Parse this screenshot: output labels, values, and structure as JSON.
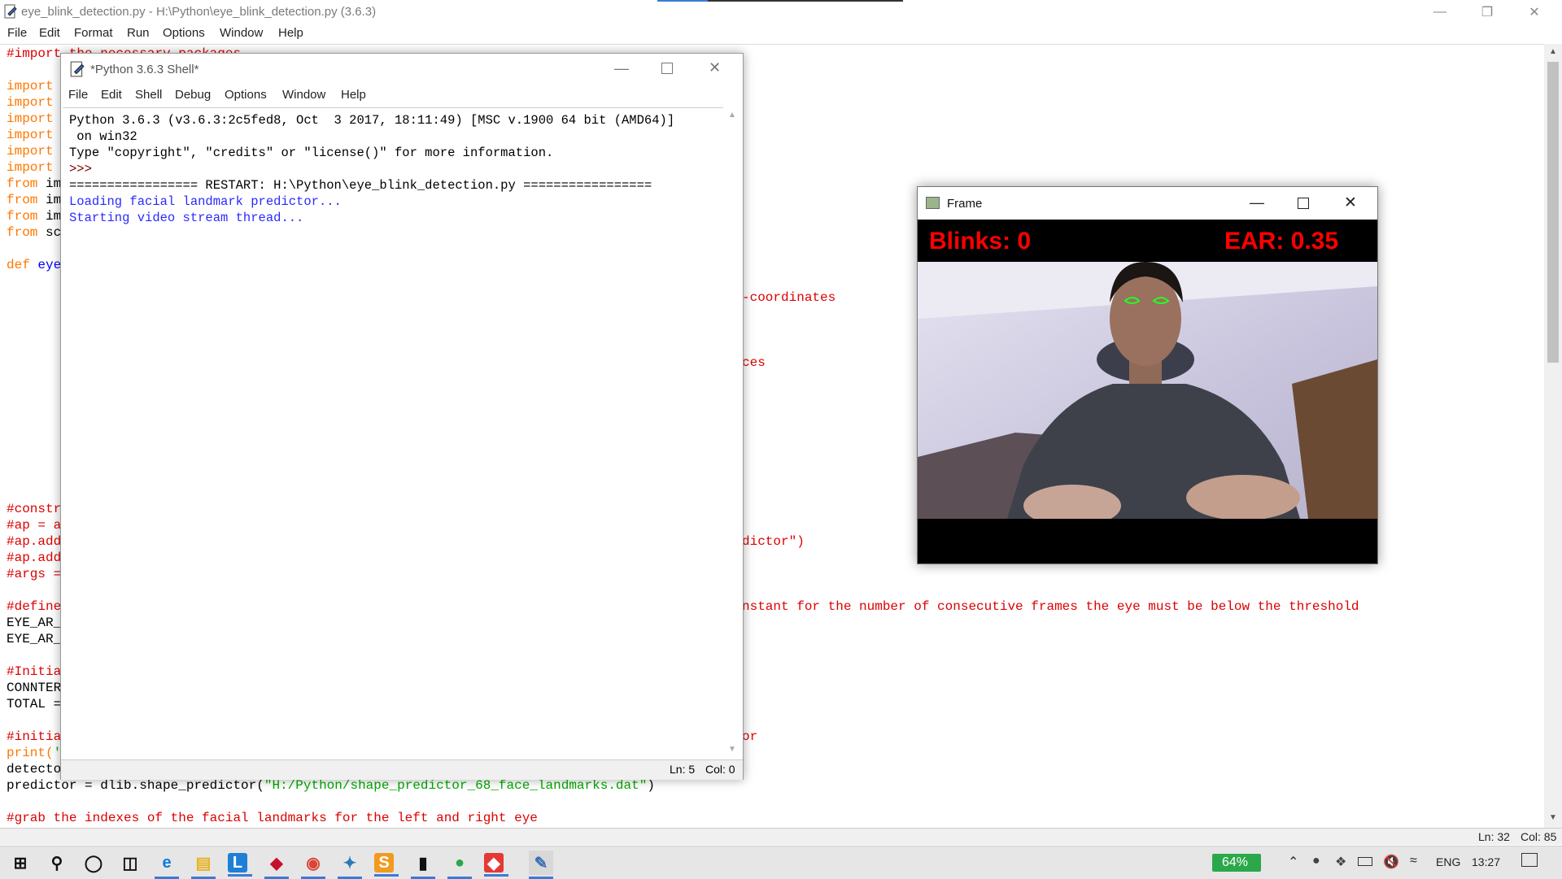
{
  "editor": {
    "title": "eye_blink_detection.py - H:\\Python\\eye_blink_detection.py (3.6.3)",
    "menu": [
      "File",
      "Edit",
      "Format",
      "Run",
      "Options",
      "Window",
      "Help"
    ],
    "code_lines": [
      {
        "parts": [
          {
            "t": "#import",
            "c": "cm"
          },
          {
            "t": " the necessary packages",
            "c": "cm"
          }
        ]
      },
      {
        "parts": []
      },
      {
        "parts": [
          {
            "t": "import",
            "c": "kw"
          }
        ]
      },
      {
        "parts": [
          {
            "t": "import",
            "c": "kw"
          }
        ]
      },
      {
        "parts": [
          {
            "t": "import",
            "c": "kw"
          }
        ]
      },
      {
        "parts": [
          {
            "t": "import",
            "c": "kw"
          }
        ]
      },
      {
        "parts": [
          {
            "t": "import",
            "c": "kw"
          }
        ]
      },
      {
        "parts": [
          {
            "t": "import",
            "c": "kw"
          }
        ]
      },
      {
        "parts": [
          {
            "t": "from",
            "c": "kw"
          },
          {
            "t": " im",
            "c": "tx"
          }
        ]
      },
      {
        "parts": [
          {
            "t": "from",
            "c": "kw"
          },
          {
            "t": " im",
            "c": "tx"
          }
        ]
      },
      {
        "parts": [
          {
            "t": "from",
            "c": "kw"
          },
          {
            "t": " im",
            "c": "tx"
          }
        ]
      },
      {
        "parts": [
          {
            "t": "from",
            "c": "kw"
          },
          {
            "t": " sc",
            "c": "tx"
          }
        ]
      },
      {
        "parts": []
      },
      {
        "parts": [
          {
            "t": "def",
            "c": "kw"
          },
          {
            "t": " eye",
            "c": "df"
          }
        ]
      }
    ],
    "code_lines_lower": [
      {
        "parts": [
          {
            "t": "#constr",
            "c": "cm"
          }
        ]
      },
      {
        "parts": [
          {
            "t": "#ap = a",
            "c": "cm"
          }
        ]
      },
      {
        "parts": [
          {
            "t": "#ap.add",
            "c": "cm"
          }
        ]
      },
      {
        "parts": [
          {
            "t": "#ap.add",
            "c": "cm"
          }
        ]
      },
      {
        "parts": [
          {
            "t": "#args =",
            "c": "cm"
          }
        ]
      },
      {
        "parts": []
      },
      {
        "parts": [
          {
            "t": "#define",
            "c": "cm"
          }
        ]
      },
      {
        "parts": [
          {
            "t": "EYE_AR_",
            "c": "tx"
          }
        ]
      },
      {
        "parts": [
          {
            "t": "EYE_AR_",
            "c": "tx"
          }
        ]
      },
      {
        "parts": []
      },
      {
        "parts": [
          {
            "t": "#Initia",
            "c": "cm"
          }
        ]
      },
      {
        "parts": [
          {
            "t": "CONNTER",
            "c": "tx"
          }
        ]
      },
      {
        "parts": [
          {
            "t": "TOTAL =",
            "c": "tx"
          }
        ]
      },
      {
        "parts": []
      },
      {
        "parts": [
          {
            "t": "#initia",
            "c": "cm"
          }
        ]
      },
      {
        "parts": [
          {
            "t": "print(",
            "c": "kw"
          },
          {
            "t": "'",
            "c": "st"
          }
        ]
      },
      {
        "parts": [
          {
            "t": "detecto",
            "c": "tx"
          }
        ]
      },
      {
        "parts": [
          {
            "t": "predictor = dlib.shape_predictor(",
            "c": "tx"
          },
          {
            "t": "\"H:/Python/shape_predictor_68_face_landmarks.dat\"",
            "c": "st"
          },
          {
            "t": ")",
            "c": "tx"
          }
        ]
      },
      {
        "parts": []
      },
      {
        "parts": [
          {
            "t": "#grab the indexes of the facial landmarks for the left and right eye",
            "c": "cm"
          }
        ]
      }
    ],
    "right_fragments": [
      {
        "text": "-coordinates",
        "line": 15
      },
      {
        "text": "ces",
        "line": 19
      },
      {
        "text": "dictor\")",
        "line": 30
      },
      {
        "text": "nstant for the number of consecutive frames the eye must be below the threshold",
        "line": 34
      },
      {
        "text": "or",
        "line": 42
      }
    ],
    "status": {
      "ln": "Ln: 32",
      "col": "Col: 85"
    }
  },
  "shell": {
    "title": "*Python 3.6.3 Shell*",
    "menu": [
      "File",
      "Edit",
      "Shell",
      "Debug",
      "Options",
      "Window",
      "Help"
    ],
    "lines": [
      {
        "t": "Python 3.6.3 (v3.6.3:2c5fed8, Oct  3 2017, 18:11:49) [MSC v.1900 64 bit (AMD64)]",
        "c": "#000"
      },
      {
        "t": " on win32",
        "c": "#000"
      },
      {
        "t": "Type \"copyright\", \"credits\" or \"license()\" for more information.",
        "c": "#000"
      },
      {
        "t": ">>> ",
        "c": "#7a0000"
      },
      {
        "t": "================= RESTART: H:\\Python\\eye_blink_detection.py =================",
        "c": "#000"
      },
      {
        "t": "Loading facial landmark predictor...",
        "c": "#2a2aff"
      },
      {
        "t": "Starting video stream thread...",
        "c": "#2a2aff"
      }
    ],
    "status": {
      "ln": "Ln: 5",
      "col": "Col: 0"
    }
  },
  "frame_window": {
    "title": "Frame",
    "blinks_label": "Blinks: 0",
    "ear_label": "EAR: 0.35"
  },
  "taskbar": {
    "icons": [
      "windows-start-icon",
      "search-icon",
      "cortana-icon",
      "task-view-icon",
      "edge-icon",
      "file-explorer-icon",
      "l-app-icon",
      "mcafee-icon",
      "chrome-icon",
      "feather-app-icon",
      "sublime-text-icon",
      "terminal-icon",
      "green-app-icon",
      "anydesk-icon",
      "python-idle-icon"
    ],
    "battery": "64%",
    "language": "ENG",
    "time": "13:27"
  }
}
